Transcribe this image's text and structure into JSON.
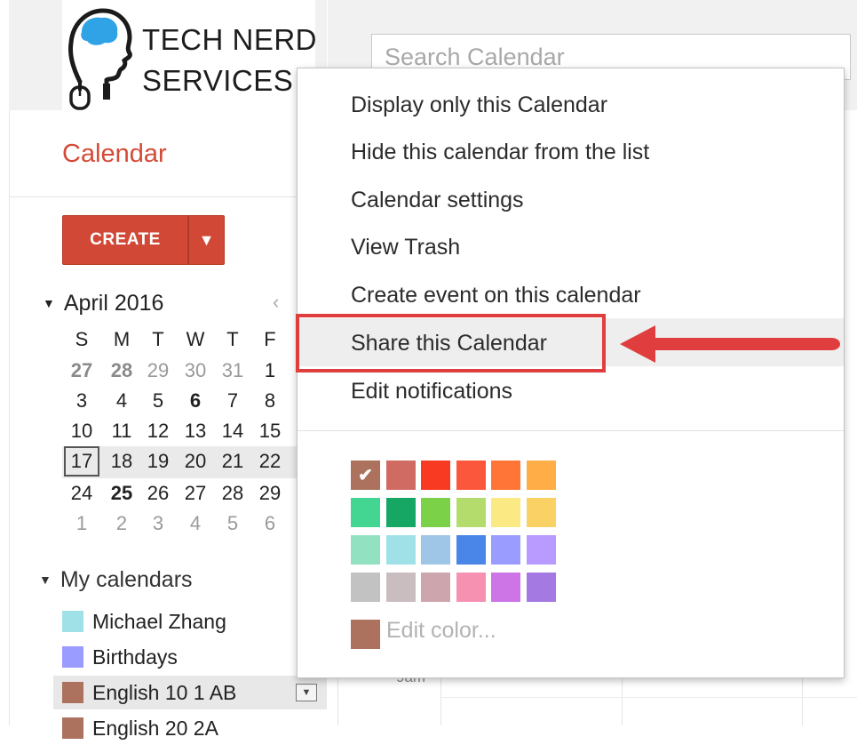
{
  "branding": {
    "line1": "TECH NERD",
    "line2": "SERVICES"
  },
  "search": {
    "placeholder": "Search Calendar"
  },
  "app_title": "Calendar",
  "create": {
    "label": "CREATE",
    "dropdown_icon": "caret-down-icon"
  },
  "mini_calendar": {
    "month_label": "April 2016",
    "weekdays": [
      "S",
      "M",
      "T",
      "W",
      "T",
      "F"
    ],
    "weeks": [
      [
        "27",
        "28",
        "29",
        "30",
        "31",
        "1"
      ],
      [
        "3",
        "4",
        "5",
        "6",
        "7",
        "8"
      ],
      [
        "10",
        "11",
        "12",
        "13",
        "14",
        "15"
      ],
      [
        "17",
        "18",
        "19",
        "20",
        "21",
        "22"
      ],
      [
        "24",
        "25",
        "26",
        "27",
        "28",
        "29"
      ],
      [
        "1",
        "2",
        "3",
        "4",
        "5",
        "6"
      ]
    ],
    "today": "17"
  },
  "my_calendars": {
    "label": "My calendars",
    "items": [
      {
        "name": "Michael Zhang",
        "color": "#9fe1e7"
      },
      {
        "name": "Birthdays",
        "color": "#9a9cff"
      },
      {
        "name": "English 10 1 AB",
        "color": "#ac725e"
      },
      {
        "name": "English 20 2A",
        "color": "#ac725e"
      }
    ]
  },
  "context_menu": {
    "items": [
      "Display only this Calendar",
      "Hide this calendar from the list",
      "Calendar settings",
      "View Trash",
      "Create event on this calendar",
      "Share this Calendar",
      "Edit notifications"
    ],
    "highlighted_item": "Share this Calendar",
    "selected_color": "#ac725e",
    "color_rows": [
      [
        "#ac725e",
        "#d06b64",
        "#f83a22",
        "#fa573c",
        "#ff7537",
        "#ffad46"
      ],
      [
        "#42d692",
        "#16a765",
        "#7bd148",
        "#b3dc6c",
        "#fbe983",
        "#fad165"
      ],
      [
        "#92e1c0",
        "#9fe1e7",
        "#9fc6e7",
        "#4986e7",
        "#9a9cff",
        "#b99aff"
      ],
      [
        "#c2c2c2",
        "#cabdbf",
        "#cca6ac",
        "#f691b2",
        "#cd74e6",
        "#a47ae2"
      ]
    ],
    "edit_color_label": "Edit color...",
    "custom_color": "#ac725e"
  },
  "annotation": {
    "color": "#e03e3e"
  },
  "main_view": {
    "time_label": "9am"
  }
}
